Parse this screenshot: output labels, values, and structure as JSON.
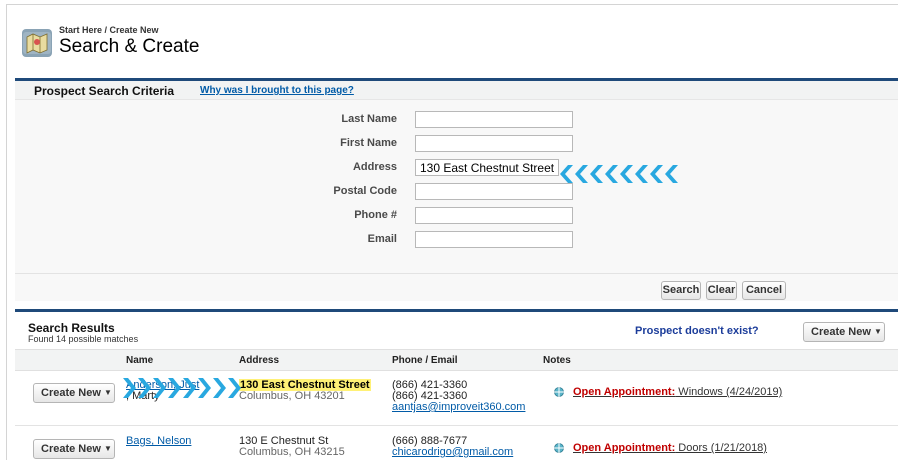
{
  "header": {
    "breadcrumb": "Start Here / Create New",
    "title": "Search & Create",
    "icon": "map-icon"
  },
  "criteria": {
    "title": "Prospect Search Criteria",
    "why_link": "Why was I brought to this page?",
    "fields": [
      {
        "label": "Last Name",
        "value": ""
      },
      {
        "label": "First Name",
        "value": ""
      },
      {
        "label": "Address",
        "value": "130 East Chestnut Street"
      },
      {
        "label": "Postal Code",
        "value": ""
      },
      {
        "label": "Phone #",
        "value": ""
      },
      {
        "label": "Email",
        "value": ""
      }
    ],
    "buttons": {
      "search": "Search",
      "clear": "Clear",
      "cancel": "Cancel"
    },
    "arrow_color": "#29a8e0"
  },
  "results": {
    "title": "Search Results",
    "count": "Found 14 possible matches",
    "no_exist": "Prospect doesn't exist?",
    "create_new": "Create New",
    "columns": [
      "Name",
      "Address",
      "Phone / Email",
      "Notes"
    ],
    "rows": [
      {
        "button": "Create New",
        "name": "Anderson, Just",
        "name_line2": ", Marty",
        "address": "130 East Chestnut Street",
        "city": "Columbus, OH 43201",
        "phone1": "(866) 421-3360",
        "phone2": "(866) 421-3360",
        "email": "aantjas@improveit360.com",
        "note_label": "Open Appointment:",
        "note_text": " Windows (4/24/2019)"
      },
      {
        "button": "Create New",
        "name": "Bags, Nelson",
        "address": "130 E Chestnut St",
        "city": "Columbus, OH 43215",
        "phone1": "(666) 888-7677",
        "email": "chicarodrigo@gmail.com",
        "note_label": "Open Appointment:",
        "note_text": " Doors (1/21/2018)"
      }
    ]
  },
  "colors": {
    "accent": "#1f4a7a",
    "link": "#015ba7",
    "highlight": "#fff176",
    "appointment": "#c00000"
  }
}
